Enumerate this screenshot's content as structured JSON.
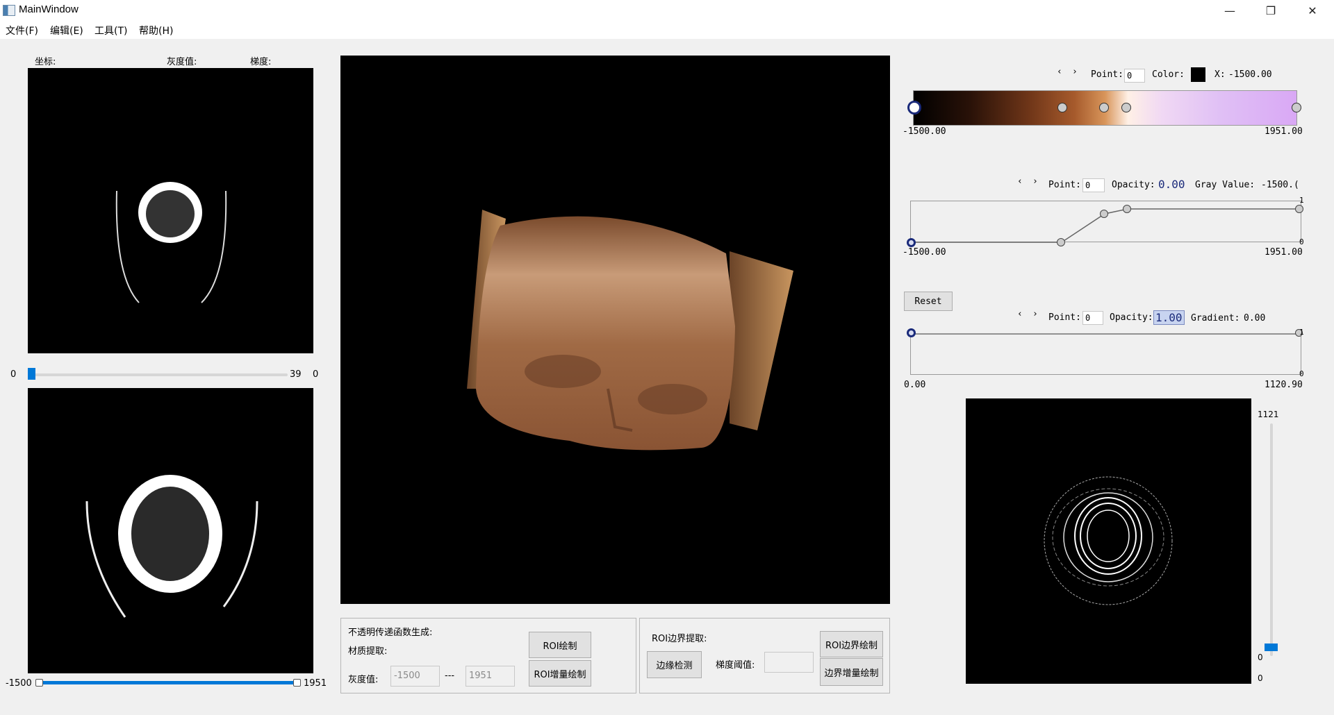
{
  "window": {
    "title": "MainWindow",
    "minimize_glyph": "—",
    "maximize_glyph": "❐",
    "close_glyph": "✕"
  },
  "menu": [
    "文件(F)",
    "编辑(E)",
    "工具(T)",
    "帮助(H)"
  ],
  "left": {
    "coord_label": "坐标:",
    "gray_label": "灰度值:",
    "gradient_label": "梯度:",
    "slice_slider": {
      "left": "0",
      "right": "39",
      "value": "0"
    },
    "range_slider": {
      "min_label": "-1500",
      "max_label": "1951"
    }
  },
  "color_tf": {
    "nav_prev": "‹",
    "nav_next": "›",
    "point_label": "Point:",
    "point_value": "0",
    "color_label": "Color:",
    "color_value": "#000000",
    "x_label": "X:",
    "x_value": "-1500.00",
    "min": "-1500.00",
    "max": "1951.00"
  },
  "opacity_tf": {
    "nav_prev": "‹",
    "nav_next": "›",
    "point_label": "Point:",
    "point_value": "0",
    "opacity_label": "Opacity:",
    "opacity_value": "0.00",
    "gray_label": "Gray Value:",
    "gray_value": "-1500.(",
    "min": "-1500.00",
    "max": "1951.00",
    "y_top": "1",
    "y_bottom": "0"
  },
  "reset_label": "Reset",
  "gradient_tf": {
    "nav_prev": "‹",
    "nav_next": "›",
    "point_label": "Point:",
    "point_value": "0",
    "opacity_label": "Opacity:",
    "opacity_value": "1.00",
    "gradient_label": "Gradient:",
    "gradient_value": "0.00",
    "min": "0.00",
    "max": "1120.90",
    "y_top": "1",
    "y_bottom": "0"
  },
  "right_slider": {
    "top": "1121",
    "value": "0",
    "bottom": "0"
  },
  "opacity_group": {
    "title": "不透明传递函数生成:",
    "material_label": "材质提取:",
    "gray_label": "灰度值:",
    "min_value": "-1500",
    "separator": "---",
    "max_value": "1951",
    "roi_draw": "ROI绘制",
    "roi_incremental": "ROI增量绘制"
  },
  "boundary_group": {
    "title": "ROI边界提取:",
    "edge_detect": "边缘检测",
    "threshold_label": "梯度阈值:",
    "threshold_value": "",
    "roi_boundary_draw": "ROI边界绘制",
    "boundary_incremental": "边界增量绘制"
  },
  "colors": {
    "accent": "#0078d7",
    "lut_end": "#d9a8f5"
  }
}
